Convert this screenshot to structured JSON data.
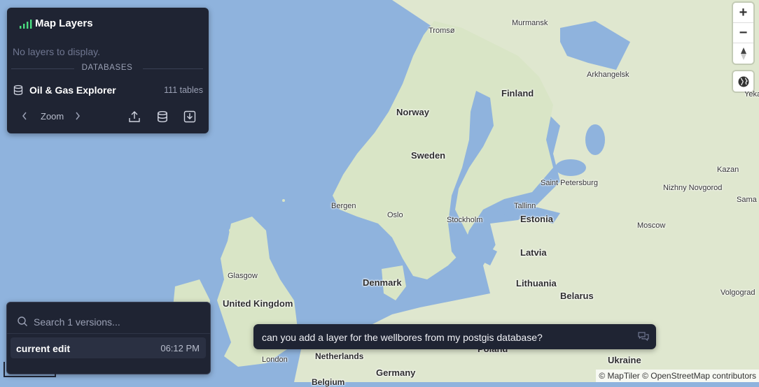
{
  "layers_panel": {
    "title": "Map Layers",
    "empty_message": "No layers to display.",
    "section_label": "DATABASES",
    "database": {
      "name": "Oil & Gas Explorer",
      "table_count": "111 tables"
    },
    "zoom_label": "Zoom",
    "accent_color": "#4ade80"
  },
  "versions_panel": {
    "search_placeholder": "Search 1 versions...",
    "versions": [
      {
        "name": "current edit",
        "time": "06:12 PM"
      }
    ]
  },
  "chat": {
    "message": "can you add a layer for the wellbores from my postgis database?"
  },
  "map_controls": {
    "zoom_in": "+",
    "zoom_out": "−"
  },
  "attribution": "© MapTiler © OpenStreetMap contributors",
  "places": {
    "tromso": "Tromsø",
    "murmansk": "Murmansk",
    "finland": "Finland",
    "arkhangelsk": "Arkhangelsk",
    "norway": "Norway",
    "sweden": "Sweden",
    "saint_petersburg": "Saint Petersburg",
    "kazan": "Kazan",
    "nizhny": "Nizhny Novgorod",
    "bergen": "Bergen",
    "oslo": "Oslo",
    "stockholm": "Stockholm",
    "tallinn": "Tallinn",
    "estonia": "Estonia",
    "moscow": "Moscow",
    "latvia": "Latvia",
    "glasgow": "Glasgow",
    "denmark": "Denmark",
    "lithuania": "Lithuania",
    "belarus": "Belarus",
    "uk": "United Kingdom",
    "volgograd": "Volgograd",
    "london": "London",
    "netherlands": "Netherlands",
    "germany": "Germany",
    "poland": "Poland",
    "ukraine": "Ukraine",
    "yeka": "Yeka",
    "sama": "Sama",
    "belgium": "Belgium"
  }
}
